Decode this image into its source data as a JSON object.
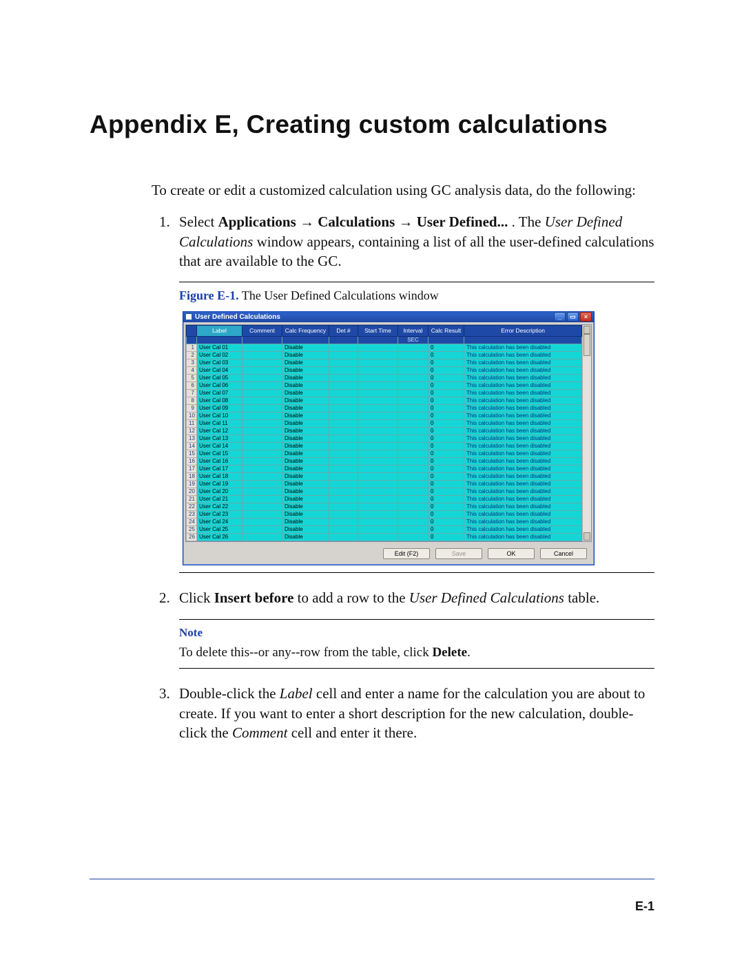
{
  "title": "Appendix E, Creating custom calculations",
  "intro": "To create or edit a customized calculation using GC analysis data, do the following:",
  "step1": {
    "pre": "Select ",
    "menu": "Applications → Calculations → User Defined...",
    "mid": ".  The ",
    "winname": "User Defined Calculations",
    "post": " window appears, containing a list of all the user-defined calculations that are available to the GC."
  },
  "figure": {
    "num": "Figure E-1.",
    "caption": "  The User Defined Calculations window"
  },
  "window": {
    "title": "User Defined Calculations",
    "columns": [
      "Label",
      "Comment",
      "Calc Frequency",
      "Det #",
      "Start Time",
      "Interval",
      "Calc Result",
      "Error Description"
    ],
    "sub_interval": "SEC",
    "calc_freq_value": "Disable",
    "calc_result_value": "0",
    "error_value": "This calculation has been disabled",
    "rows": [
      "User Cal 01",
      "User Cal 02",
      "User Cal 03",
      "User Cal 04",
      "User Cal 05",
      "User Cal 06",
      "User Cal 07",
      "User Cal 08",
      "User Cal 09",
      "User Cal 10",
      "User Cal 11",
      "User Cal 12",
      "User Cal 13",
      "User Cal 14",
      "User Cal 15",
      "User Cal 16",
      "User Cal 17",
      "User Cal 18",
      "User Cal 19",
      "User Cal 20",
      "User Cal 21",
      "User Cal 22",
      "User Cal 23",
      "User Cal 24",
      "User Cal 25",
      "User Cal 26"
    ],
    "buttons": {
      "edit": "Edit (F2)",
      "save": "Save",
      "ok": "OK",
      "cancel": "Cancel"
    }
  },
  "step2": {
    "pre": "Click ",
    "cmd": "Insert before",
    "mid": " to add a row to the ",
    "tbl": "User Defined Calculations",
    "post": " table."
  },
  "note": {
    "label": "Note",
    "pre": "To delete this--or any--row from the table, click ",
    "cmd": "Delete",
    "post": "."
  },
  "step3": {
    "pre": "Double-click the ",
    "c1": "Label",
    "mid1": " cell and enter a name for the calculation you are about to create.  If you want to enter a short description for the new calculation, double-click the ",
    "c2": "Comment",
    "mid2": " cell and enter it there."
  },
  "page_num": "E-1"
}
